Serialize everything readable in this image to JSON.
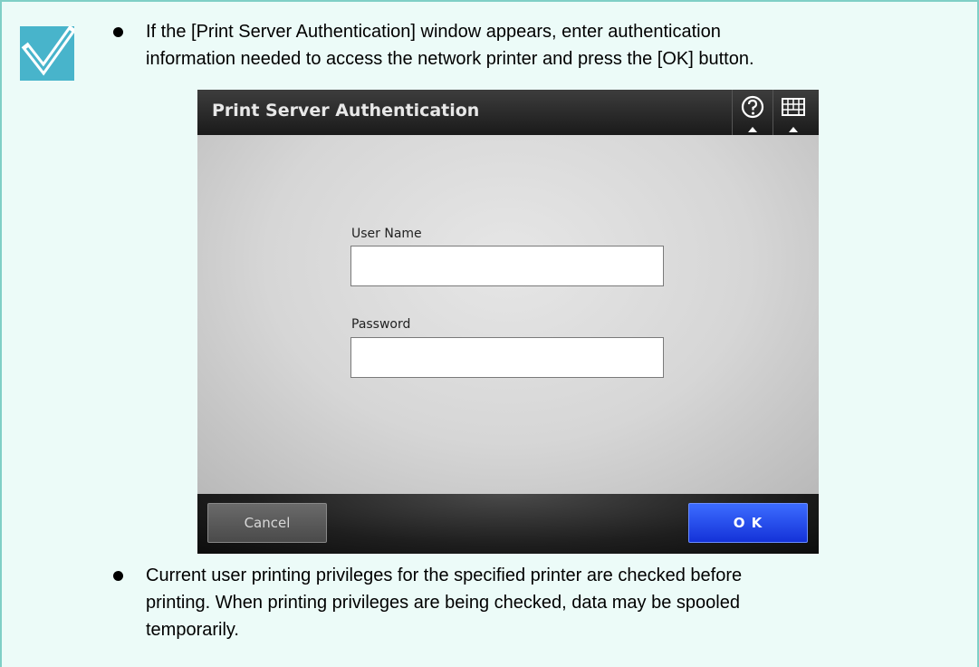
{
  "notes": [
    "If the [Print Server Authentication] window appears, enter authentication\ninformation needed to access the network printer and press the [OK] button.",
    "Current user printing privileges for the specified printer are checked before\nprinting. When printing privileges are being checked, data may be spooled\ntemporarily."
  ],
  "icons": {
    "check": "checkmark-icon",
    "help": "help-icon",
    "keyboard": "keyboard-icon"
  },
  "colors": {
    "panel_border": "#7fcfc6",
    "panel_background": "#ecfbf8",
    "check_icon": "#48b4cb",
    "ok_button": "#1f4bf0"
  },
  "dialog": {
    "title": "Print Server Authentication",
    "fields": {
      "user_name": {
        "label": "User Name",
        "value": ""
      },
      "password": {
        "label": "Password",
        "value": ""
      }
    },
    "buttons": {
      "cancel": "Cancel",
      "ok": "O K"
    }
  }
}
